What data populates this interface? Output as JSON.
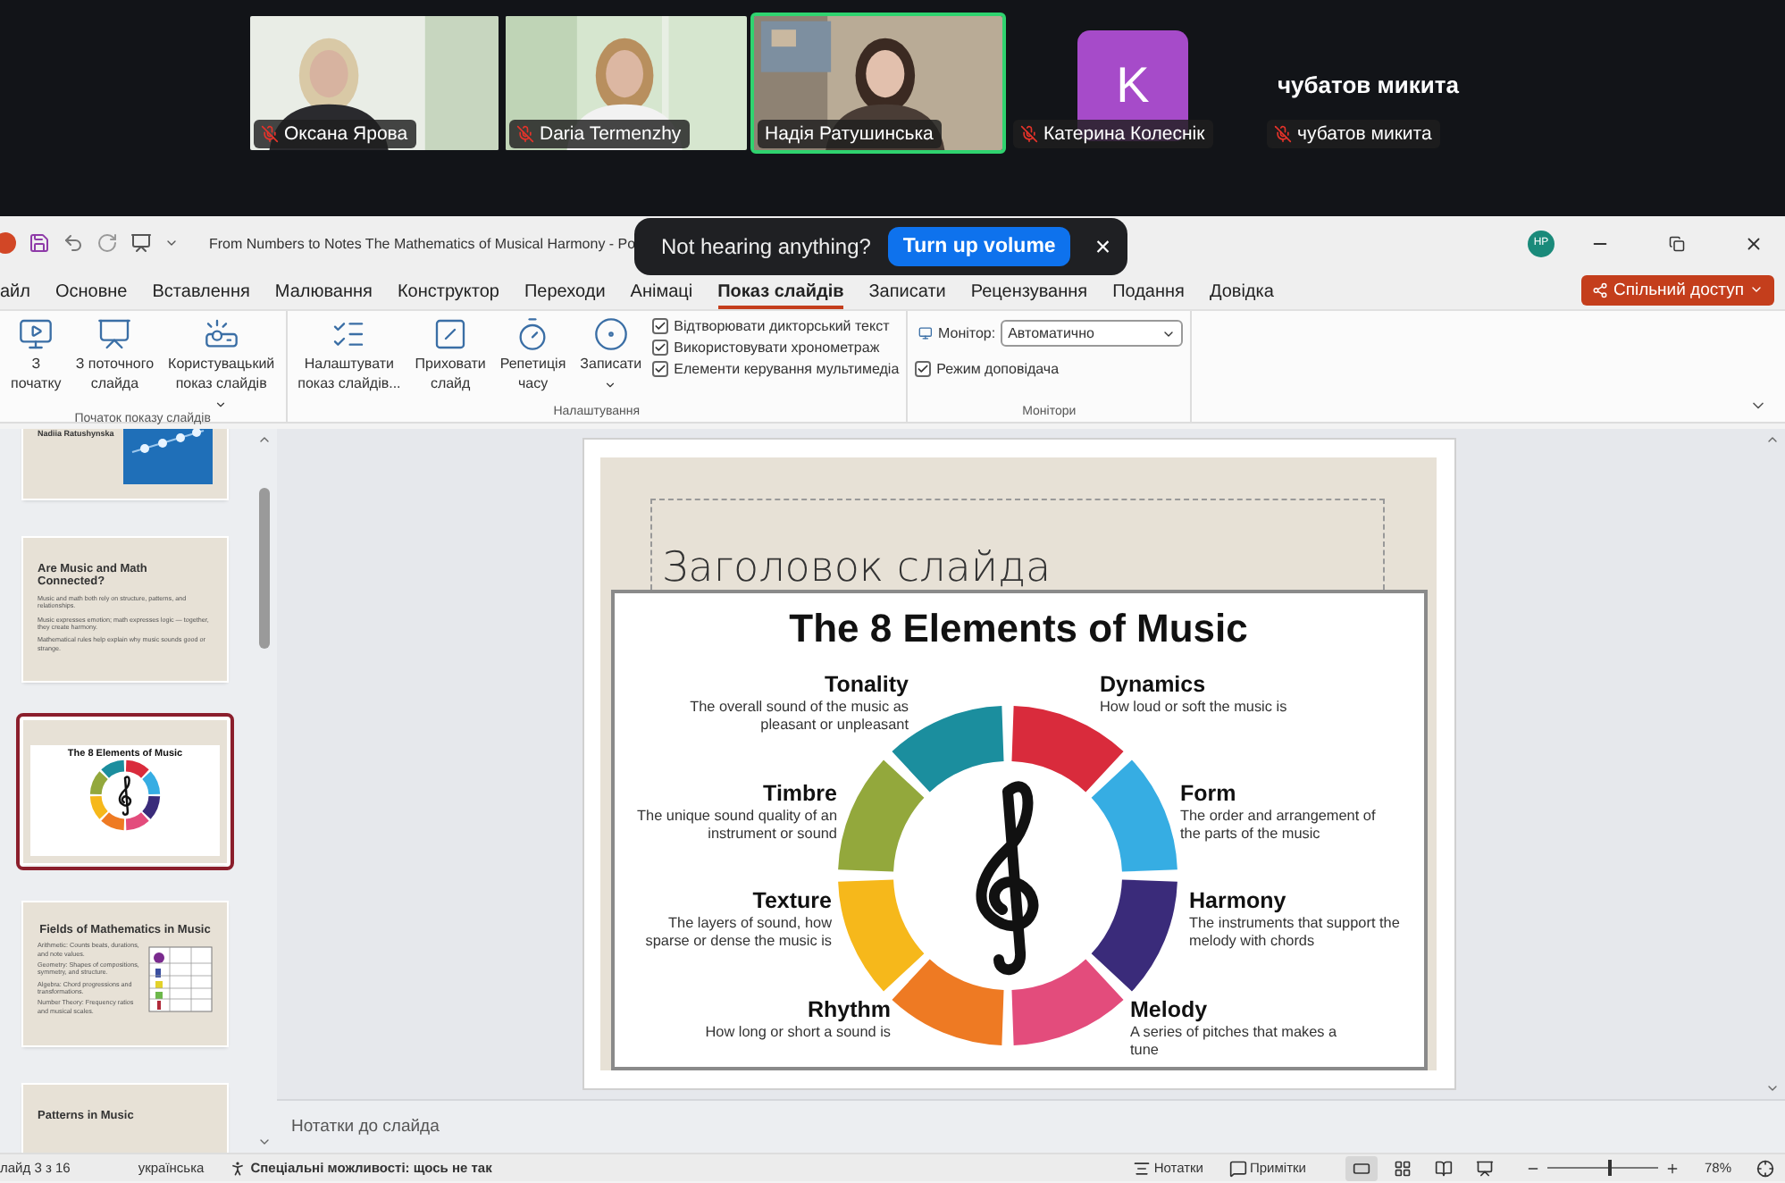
{
  "meeting": {
    "participants": [
      {
        "kind": "video",
        "name": "Оксана Ярова",
        "muted": true,
        "speaking": false
      },
      {
        "kind": "video",
        "name": "Daria Termenzhy",
        "muted": true,
        "speaking": false
      },
      {
        "kind": "video",
        "name": "Надія Ратушинська",
        "muted": false,
        "speaking": true
      },
      {
        "kind": "avatar",
        "initial": "K",
        "color": "#a64bc9",
        "name": "Катерина Колеснік",
        "muted": true,
        "speaking": false
      },
      {
        "kind": "name",
        "display": "чубатов микита",
        "name": "чубатов микита",
        "muted": true,
        "speaking": false
      }
    ]
  },
  "toast": {
    "message": "Not hearing anything?",
    "action": "Turn up volume",
    "close": "×"
  },
  "window": {
    "title": "From Numbers to Notes The Mathematics of Musical Harmony - Po",
    "account": "HP"
  },
  "share_button": "Спільний доступ",
  "ribbon": {
    "tabs": [
      {
        "label": "айл",
        "selected": false
      },
      {
        "label": "Основне",
        "selected": false
      },
      {
        "label": "Вставлення",
        "selected": false
      },
      {
        "label": "Малювання",
        "selected": false
      },
      {
        "label": "Конструктор",
        "selected": false
      },
      {
        "label": "Переходи",
        "selected": false
      },
      {
        "label": "Анімаці",
        "selected": false
      },
      {
        "label": "Показ слайдів",
        "selected": true
      },
      {
        "label": "Записати",
        "selected": false
      },
      {
        "label": "Рецензування",
        "selected": false
      },
      {
        "label": "Подання",
        "selected": false
      },
      {
        "label": "Довідка",
        "selected": false
      }
    ],
    "groups": [
      {
        "label": "Початок показу слайдів",
        "items": [
          {
            "kind": "button",
            "label": "З\nпочатку",
            "dropdown": false
          },
          {
            "kind": "button",
            "label": "З поточного\nслайда",
            "dropdown": false
          },
          {
            "kind": "button",
            "label": "Користувацький\nпоказ слайдів",
            "dropdown": true
          }
        ]
      },
      {
        "label": "Налаштування",
        "items": [
          {
            "kind": "button",
            "label": "Налаштувати\nпоказ слайдів...",
            "dropdown": false
          },
          {
            "kind": "button",
            "label": "Приховати\nслайд",
            "dropdown": false
          },
          {
            "kind": "button",
            "label": "Репетиція\nчасу",
            "dropdown": false
          },
          {
            "kind": "button",
            "label": "Записати",
            "dropdown": true
          },
          {
            "kind": "checks",
            "items": [
              {
                "label": "Відтворювати дикторський текст",
                "checked": true
              },
              {
                "label": "Використовувати хронометраж",
                "checked": true
              },
              {
                "label": "Елементи керування мультимедіа",
                "checked": true
              }
            ]
          }
        ]
      },
      {
        "label": "Монітори",
        "items": [
          {
            "kind": "monitor",
            "label": "Монітор:",
            "value": "Автоматично",
            "checks": [
              {
                "label": "Режим доповідача",
                "checked": true
              }
            ]
          }
        ]
      }
    ]
  },
  "thumbnails": [
    {
      "kind": "title",
      "title": "Nadiia Ratushynska",
      "selected": false
    },
    {
      "kind": "bullets",
      "title": "Are Music and Math Connected?",
      "bullets": [
        "Music and math both rely on structure, patterns, and relationships.",
        "Music expresses emotion; math expresses logic — together, they create harmony.",
        "Mathematical rules help explain why music sounds good or strange."
      ],
      "selected": false
    },
    {
      "kind": "infographic",
      "title": "The 8 Elements of Music",
      "selected": true
    },
    {
      "kind": "table",
      "title": "Fields of Mathematics in Music",
      "bullets": [
        "Arithmetic: Counts beats, durations, and note values.",
        "Geometry: Shapes of compositions, symmetry, and structure.",
        "Algebra: Chord progressions and transformations.",
        "Number Theory: Frequency ratios and musical scales."
      ],
      "selected": false
    },
    {
      "kind": "bullets",
      "title": "Patterns in Music",
      "selected": false
    }
  ],
  "slide": {
    "title_placeholder": "Заголовок слайда",
    "infographic": {
      "title": "The 8 Elements of Music",
      "elements": [
        {
          "name": "Tonality",
          "description": "The overall sound of the music as pleasant or unpleasant",
          "color": "#1b8e9e"
        },
        {
          "name": "Dynamics",
          "description": "How loud or soft the music is",
          "color": "#d92b3c"
        },
        {
          "name": "Timbre",
          "description": "The unique sound quality of an instrument or sound",
          "color": "#93a83c"
        },
        {
          "name": "Form",
          "description": "The order and arrangement of the parts of the music",
          "color": "#36ade3"
        },
        {
          "name": "Texture",
          "description": "The layers of sound, how sparse or dense the music is",
          "color": "#f6b81b"
        },
        {
          "name": "Harmony",
          "description": "The instruments that support the melody with chords",
          "color": "#3a2b7a"
        },
        {
          "name": "Rhythm",
          "description": "How long or short a sound is",
          "color": "#ee7a23"
        },
        {
          "name": "Melody",
          "description": "A series of pitches that makes a tune",
          "color": "#e34c7c"
        }
      ]
    }
  },
  "notes_placeholder": "Нотатки до слайда",
  "status_bar": {
    "slide": "лайд 3 з 16",
    "language": "українська",
    "accessibility": "Спеціальні можливості: щось не так",
    "notes": "Нотатки",
    "comments": "Примітки",
    "views": [
      {
        "kind": "normal",
        "selected": true
      },
      {
        "kind": "sorter",
        "selected": false
      },
      {
        "kind": "reading",
        "selected": false
      },
      {
        "kind": "slideshow",
        "selected": false
      }
    ],
    "zoom": {
      "level": 0.55,
      "reading": "78%"
    }
  }
}
